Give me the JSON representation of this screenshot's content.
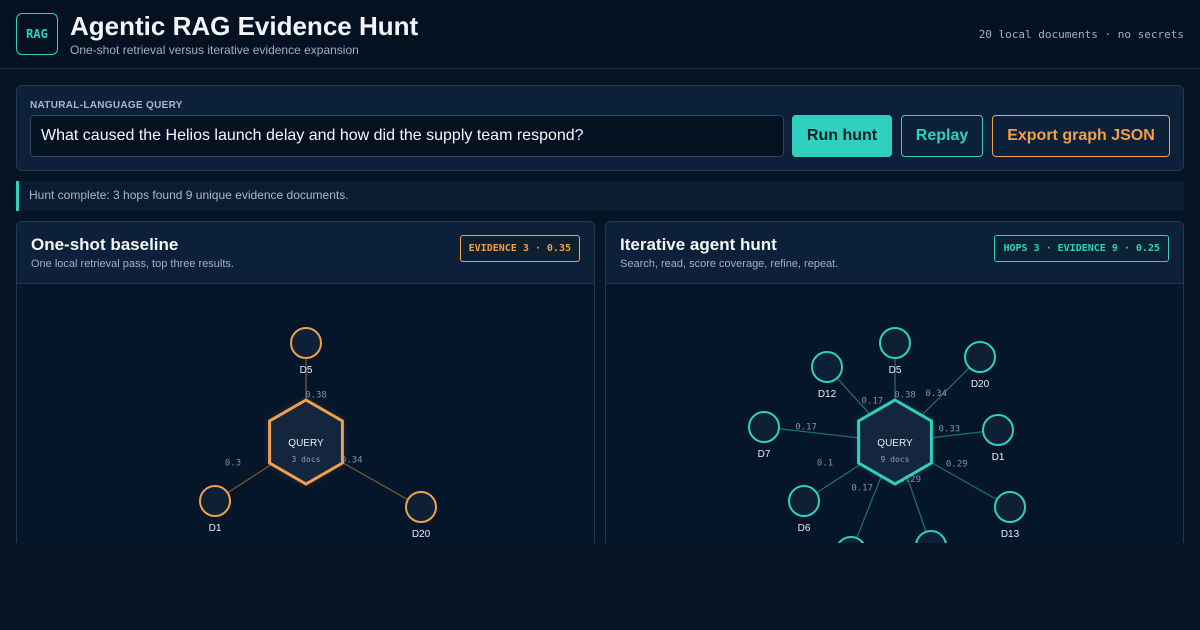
{
  "app": {
    "logo": "RAG",
    "title": "Agentic RAG Evidence Hunt",
    "subtitle": "One-shot retrieval versus iterative evidence expansion",
    "meta": "20 local documents · no secrets"
  },
  "query": {
    "label": "NATURAL-LANGUAGE QUERY",
    "value": "What caused the Helios launch delay and how did the supply team respond?",
    "buttons": {
      "run": "Run hunt",
      "replay": "Replay",
      "export": "Export graph JSON"
    }
  },
  "status": "Hunt complete: 3 hops found 9 unique evidence documents.",
  "colors": {
    "accent_teal": "#2fd0bf",
    "accent_orange": "#f0a04c",
    "background": "#061526"
  },
  "baseline": {
    "title": "One-shot baseline",
    "subtitle": "One local retrieval pass, top three results.",
    "badge": "EVIDENCE 3 · 0.35",
    "center_label": "QUERY",
    "center_sub": "3 docs",
    "nodes": [
      {
        "id": "D5",
        "score": "0.38"
      },
      {
        "id": "D1",
        "score": "0.3"
      },
      {
        "id": "D20",
        "score": "0.34"
      }
    ]
  },
  "agent": {
    "title": "Iterative agent hunt",
    "subtitle": "Search, read, score coverage, refine, repeat.",
    "badge": "HOPS 3 · EVIDENCE 9 · 0.25",
    "center_label": "QUERY",
    "center_sub": "9 docs",
    "nodes": [
      {
        "id": "D5",
        "score": "0.38"
      },
      {
        "id": "D20",
        "score": "0.34"
      },
      {
        "id": "D1",
        "score": "0.33"
      },
      {
        "id": "D13",
        "score": "0.29"
      },
      {
        "id": "",
        "score": "0.29"
      },
      {
        "id": "",
        "score": "0.17"
      },
      {
        "id": "D6",
        "score": "0.1"
      },
      {
        "id": "D7",
        "score": "0.17"
      },
      {
        "id": "D12",
        "score": "0.17"
      }
    ]
  }
}
